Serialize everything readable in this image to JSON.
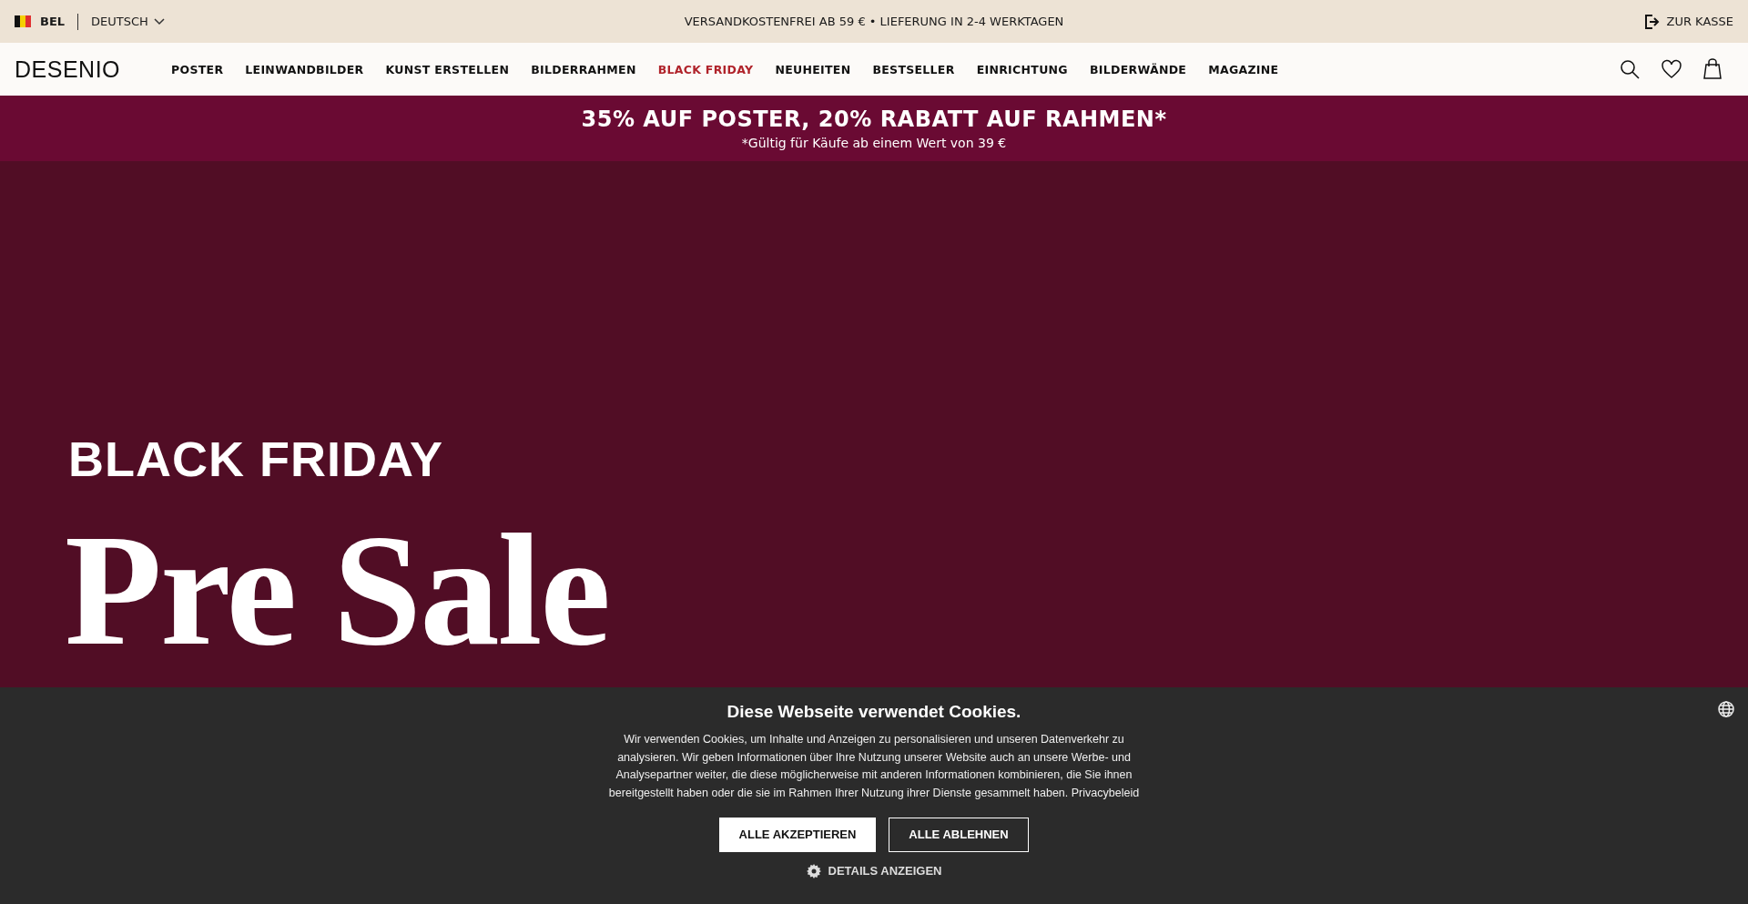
{
  "top_bar": {
    "country": "BEL",
    "language": "DEUTSCH",
    "shipping_notice": "VERSANDKOSTENFREI AB 59 € • LIEFERUNG IN 2-4 WERKTAGEN",
    "checkout_link": "ZUR KASSE"
  },
  "header": {
    "logo": "DESENIO",
    "nav": [
      {
        "label": "POSTER",
        "selected": false
      },
      {
        "label": "LEINWANDBILDER",
        "selected": false
      },
      {
        "label": "KUNST ERSTELLEN",
        "selected": false
      },
      {
        "label": "BILDERRAHMEN",
        "selected": false
      },
      {
        "label": "BLACK FRIDAY",
        "selected": true
      },
      {
        "label": "NEUHEITEN",
        "selected": false
      },
      {
        "label": "BESTSELLER",
        "selected": false
      },
      {
        "label": "EINRICHTUNG",
        "selected": false
      },
      {
        "label": "BILDERWÄNDE",
        "selected": false
      },
      {
        "label": "MAGAZINE",
        "selected": false
      }
    ]
  },
  "promo_banner": {
    "headline": "35% AUF POSTER, 20% RABATT AUF RAHMEN*",
    "note": "*Gültig für Käufe ab einem Wert von 39 €"
  },
  "hero": {
    "eyebrow": "BLACK FRIDAY",
    "title": "Pre Sale"
  },
  "cookie_banner": {
    "title": "Diese Webseite verwendet Cookies.",
    "text": "Wir verwenden Cookies, um Inhalte und Anzeigen zu personalisieren und unseren Datenverkehr zu analysieren. Wir geben Informationen über Ihre Nutzung unserer Website auch an unsere Werbe- und Analysepartner weiter, die diese möglicherweise mit anderen Informationen kombinieren, die Sie ihnen bereitgestellt haben oder die sie im Rahmen Ihrer Nutzung ihrer Dienste gesammelt haben.",
    "privacy_link": "Privacybeleid",
    "accept_button": "ALLE AKZEPTIEREN",
    "reject_button": "ALLE ABLEHNEN",
    "details_link": "DETAILS ANZEIGEN"
  }
}
